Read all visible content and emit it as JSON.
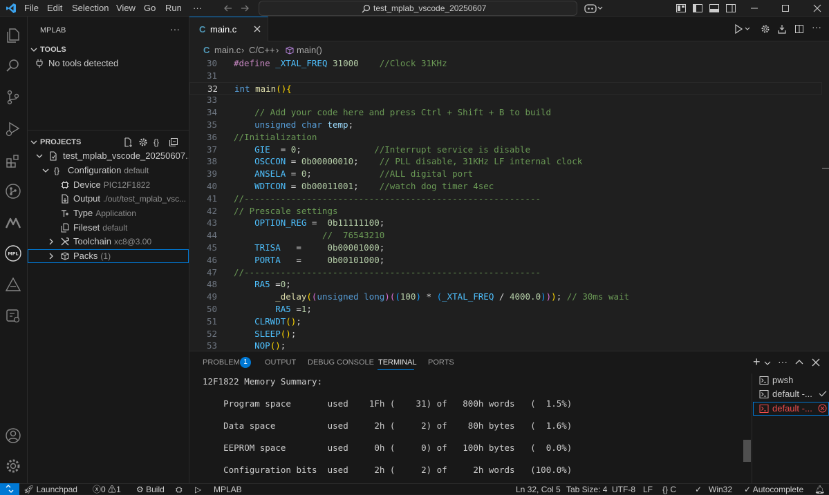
{
  "menu": [
    "File",
    "Edit",
    "Selection",
    "View",
    "Go",
    "Run",
    "···"
  ],
  "search": {
    "label": "test_mplab_vscode_20250607"
  },
  "sidebar": {
    "title": "MPLAB",
    "tools": {
      "header": "TOOLS",
      "empty": "No tools detected"
    },
    "projects": {
      "header": "PROJECTS",
      "project": "test_mplab_vscode_20250607...",
      "config_label": "Configuration",
      "config_desc": "default",
      "items": [
        {
          "label": "Device",
          "desc": "PIC12F1822"
        },
        {
          "label": "Output",
          "desc": "./out/test_mplab_vsc..."
        },
        {
          "label": "Type",
          "desc": "Application"
        },
        {
          "label": "Fileset",
          "desc": "default"
        },
        {
          "label": "Toolchain",
          "desc": "xc8@3.00"
        },
        {
          "label": "Packs",
          "desc": "(1)"
        }
      ]
    }
  },
  "tab": {
    "name": "main.c"
  },
  "breadcrumbs": [
    "main.c",
    "C/C++",
    "main()"
  ],
  "editor": {
    "current_line": 32,
    "lines": [
      {
        "n": 30,
        "tokens": [
          [
            "pp",
            "#define "
          ],
          [
            "m",
            "_XTAL_FREQ "
          ],
          [
            "n",
            "31000"
          ],
          [
            "p",
            "    "
          ],
          [
            "c",
            "//Clock 31KHz"
          ]
        ]
      },
      {
        "n": 31,
        "tokens": []
      },
      {
        "n": 32,
        "tokens": [
          [
            "k",
            "int "
          ],
          [
            "f",
            "main"
          ],
          [
            "b1",
            "()"
          ],
          [
            "b1",
            "{"
          ]
        ]
      },
      {
        "n": 33,
        "tokens": []
      },
      {
        "n": 34,
        "tokens": [
          [
            "p",
            "    "
          ],
          [
            "c",
            "// Add your code here and press Ctrl + Shift + B to build"
          ]
        ]
      },
      {
        "n": 35,
        "tokens": [
          [
            "p",
            "    "
          ],
          [
            "k",
            "unsigned char "
          ],
          [
            "v",
            "temp"
          ],
          [
            "p",
            ";"
          ]
        ]
      },
      {
        "n": 36,
        "tokens": [
          [
            "c",
            "//Initialization"
          ]
        ]
      },
      {
        "n": 37,
        "tokens": [
          [
            "p",
            "    "
          ],
          [
            "m",
            "GIE"
          ],
          [
            "p",
            "  = "
          ],
          [
            "n",
            "0"
          ],
          [
            "p",
            ";              "
          ],
          [
            "c",
            "//Interrupt service is disable"
          ]
        ]
      },
      {
        "n": 38,
        "tokens": [
          [
            "p",
            "    "
          ],
          [
            "m",
            "OSCCON"
          ],
          [
            "p",
            " = "
          ],
          [
            "n",
            "0b00000010"
          ],
          [
            "p",
            ";    "
          ],
          [
            "c",
            "// PLL disable, 31KHz LF internal clock"
          ]
        ]
      },
      {
        "n": 39,
        "tokens": [
          [
            "p",
            "    "
          ],
          [
            "m",
            "ANSELA"
          ],
          [
            "p",
            " = "
          ],
          [
            "n",
            "0"
          ],
          [
            "p",
            ";             "
          ],
          [
            "c",
            "//ALL digital port"
          ]
        ]
      },
      {
        "n": 40,
        "tokens": [
          [
            "p",
            "    "
          ],
          [
            "m",
            "WDTCON"
          ],
          [
            "p",
            " = "
          ],
          [
            "n",
            "0b00011001"
          ],
          [
            "p",
            ";    "
          ],
          [
            "c",
            "//watch dog timer 4sec"
          ]
        ]
      },
      {
        "n": 41,
        "tokens": [
          [
            "c",
            "//---------------------------------------------------------"
          ]
        ]
      },
      {
        "n": 42,
        "tokens": [
          [
            "c",
            "// Prescale settings"
          ]
        ]
      },
      {
        "n": 43,
        "tokens": [
          [
            "p",
            "    "
          ],
          [
            "m",
            "OPTION_REG"
          ],
          [
            "p",
            " =  "
          ],
          [
            "n",
            "0b11111100"
          ],
          [
            "p",
            ";"
          ]
        ]
      },
      {
        "n": 44,
        "tokens": [
          [
            "p",
            "                 "
          ],
          [
            "c",
            "//  76543210"
          ]
        ]
      },
      {
        "n": 45,
        "tokens": [
          [
            "p",
            "    "
          ],
          [
            "m",
            "TRISA"
          ],
          [
            "p",
            "   =     "
          ],
          [
            "n",
            "0b00001000"
          ],
          [
            "p",
            ";"
          ]
        ]
      },
      {
        "n": 46,
        "tokens": [
          [
            "p",
            "    "
          ],
          [
            "m",
            "PORTA"
          ],
          [
            "p",
            "   =     "
          ],
          [
            "n",
            "0b00101000"
          ],
          [
            "p",
            ";"
          ]
        ]
      },
      {
        "n": 47,
        "tokens": [
          [
            "c",
            "//---------------------------------------------------------"
          ]
        ]
      },
      {
        "n": 48,
        "tokens": [
          [
            "p",
            "    "
          ],
          [
            "m",
            "RA5"
          ],
          [
            "p",
            " ="
          ],
          [
            "n",
            "0"
          ],
          [
            "p",
            ";"
          ]
        ]
      },
      {
        "n": 49,
        "tokens": [
          [
            "p",
            "        "
          ],
          [
            "f",
            "_delay"
          ],
          [
            "b1",
            "("
          ],
          [
            "b2",
            "("
          ],
          [
            "k",
            "unsigned long"
          ],
          [
            "b2",
            ")"
          ],
          [
            "b2",
            "("
          ],
          [
            "b3",
            "("
          ],
          [
            "n",
            "100"
          ],
          [
            "b3",
            ")"
          ],
          [
            "p",
            " * "
          ],
          [
            "b3",
            "("
          ],
          [
            "m",
            "_XTAL_FREQ"
          ],
          [
            "p",
            " / "
          ],
          [
            "n",
            "4000.0"
          ],
          [
            "b3",
            ")"
          ],
          [
            "b2",
            ")"
          ],
          [
            "b1",
            ")"
          ],
          [
            "p",
            "; "
          ],
          [
            "c",
            "// 30ms wait"
          ]
        ]
      },
      {
        "n": 50,
        "tokens": [
          [
            "p",
            "        "
          ],
          [
            "m",
            "RA5"
          ],
          [
            "p",
            " ="
          ],
          [
            "n",
            "1"
          ],
          [
            "p",
            ";"
          ]
        ]
      },
      {
        "n": 51,
        "tokens": [
          [
            "p",
            "    "
          ],
          [
            "m",
            "CLRWDT"
          ],
          [
            "b1",
            "()"
          ],
          [
            "p",
            ";"
          ]
        ]
      },
      {
        "n": 52,
        "tokens": [
          [
            "p",
            "    "
          ],
          [
            "m",
            "SLEEP"
          ],
          [
            "b1",
            "()"
          ],
          [
            "p",
            ";"
          ]
        ]
      },
      {
        "n": 53,
        "tokens": [
          [
            "p",
            "    "
          ],
          [
            "m",
            "NOP"
          ],
          [
            "b1",
            "()"
          ],
          [
            "p",
            ";"
          ]
        ]
      }
    ]
  },
  "panel": {
    "tabs": [
      "PROBLEMS",
      "OUTPUT",
      "DEBUG CONSOLE",
      "TERMINAL",
      "PORTS"
    ],
    "problems_count": "1",
    "active_tab": "TERMINAL",
    "terminal_lines": [
      "12F1822 Memory Summary:",
      "",
      "    Program space       used    1Fh (    31) of   800h words   (  1.5%)",
      "",
      "    Data space          used     2h (     2) of    80h bytes   (  1.6%)",
      "",
      "    EEPROM space        used     0h (     0) of   100h bytes   (  0.0%)",
      "",
      "    Configuration bits  used     2h (     2) of     2h words   (100.0%)"
    ],
    "terminals": [
      "pwsh",
      "default -...",
      "default -..."
    ]
  },
  "statusbar": {
    "launchpad": "Launchpad",
    "errors": "0",
    "warnings": "1",
    "build": "Build",
    "mplab": "MPLAB",
    "position": "Ln 32, Col 5",
    "tabsize": "Tab Size: 4",
    "encoding": "UTF-8",
    "eol": "LF",
    "language": "C",
    "platform": "Win32",
    "autocomplete": "Autocomplete"
  },
  "colors": {
    "accent": "#0078d4",
    "editor_bg": "#1f1f1f",
    "sidebar_bg": "#181818",
    "error": "#f14c4c"
  }
}
